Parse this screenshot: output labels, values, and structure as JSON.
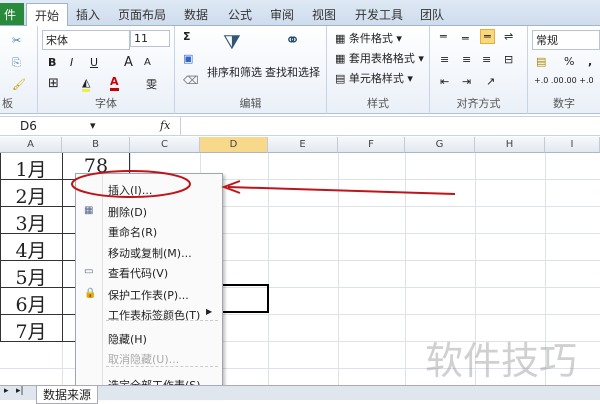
{
  "tabs": [
    "件",
    "开始",
    "插入",
    "页面布局",
    "数据",
    "公式",
    "审阅",
    "视图",
    "开发工具",
    "团队"
  ],
  "ribbon": {
    "clipboard_label": "板",
    "font_name": "宋体",
    "font_size": "11",
    "bold": "B",
    "italic": "I",
    "underline": "U",
    "grow": "A",
    "shrink": "A",
    "font_color": "A",
    "phonetic": "雯",
    "font_label": "字体",
    "sigma": "Σ",
    "sort_filter": "排序和筛选",
    "find_select": "查找和选择",
    "edit_label": "编辑",
    "cond_format": "条件格式",
    "table_format": "套用表格格式",
    "cell_style": "单元格样式",
    "style_label": "样式",
    "align_label": "对齐方式",
    "number_format": "常规",
    "percent": "%",
    "comma": ",",
    "inc_dec": "+.0 .00",
    "dec_dec": ".00 +.0",
    "number_label": "数字"
  },
  "formula_bar": {
    "name_box": "D6",
    "fx": "fx",
    "value": ""
  },
  "columns": [
    "A",
    "B",
    "C",
    "D",
    "E",
    "F",
    "G",
    "H",
    "I"
  ],
  "cells": {
    "A": [
      "1月",
      "2月",
      "3月",
      "4月",
      "5月",
      "6月",
      "7月"
    ],
    "B1": "78"
  },
  "context_menu": [
    {
      "label": "插入(I)...",
      "icon": "none",
      "disabled": false
    },
    {
      "label": "删除(D)",
      "icon": "delete-sheet-icon",
      "disabled": false
    },
    {
      "label": "重命名(R)",
      "icon": "none",
      "disabled": false
    },
    {
      "label": "移动或复制(M)...",
      "icon": "none",
      "disabled": false
    },
    {
      "label": "查看代码(V)",
      "icon": "view-code-icon",
      "disabled": false
    },
    {
      "label": "保护工作表(P)...",
      "icon": "lock-icon",
      "disabled": false
    },
    {
      "label": "工作表标签颜色(T)",
      "icon": "none",
      "disabled": false,
      "submenu": true
    },
    {
      "label": "隐藏(H)",
      "icon": "none",
      "disabled": false
    },
    {
      "label": "取消隐藏(U)...",
      "icon": "none",
      "disabled": true
    },
    {
      "label": "选定全部工作表(S)",
      "icon": "none",
      "disabled": false
    }
  ],
  "sheet_tab": "数据来源",
  "watermark": "软件技巧",
  "colors": {
    "annotation": "#c0141a",
    "selected_col": "#f8d88a",
    "file_tab": "#2a8a3c"
  }
}
